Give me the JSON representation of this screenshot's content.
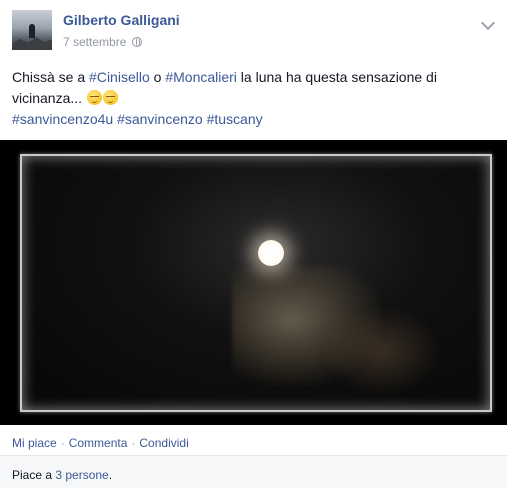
{
  "post": {
    "author": "Gilberto Galligani",
    "date": "7 settembre",
    "audience_icon": "globe-icon",
    "options_icon": "chevron-down-icon",
    "text": {
      "part1": "Chissà se a ",
      "tag1": "#Cinisello",
      "part2": " o ",
      "tag2": "#Moncalieri",
      "part3": " la luna ha questa sensazione di vicinanza...",
      "emoji": "relieved-face-emoji",
      "hashtags": [
        "#sanvincenzo4u",
        "#sanvincenzo",
        "#tuscany"
      ]
    },
    "photo_icon": "moon-night-photo"
  },
  "actions": {
    "like": "Mi piace",
    "comment": "Commenta",
    "share": "Condividi",
    "separator": "·"
  },
  "likes": {
    "prefix": "Piace a ",
    "link": "3 persone",
    "suffix": "."
  },
  "colors": {
    "link": "#3b5998",
    "meta": "#9197a3",
    "footer_bg": "#f6f7f8"
  }
}
